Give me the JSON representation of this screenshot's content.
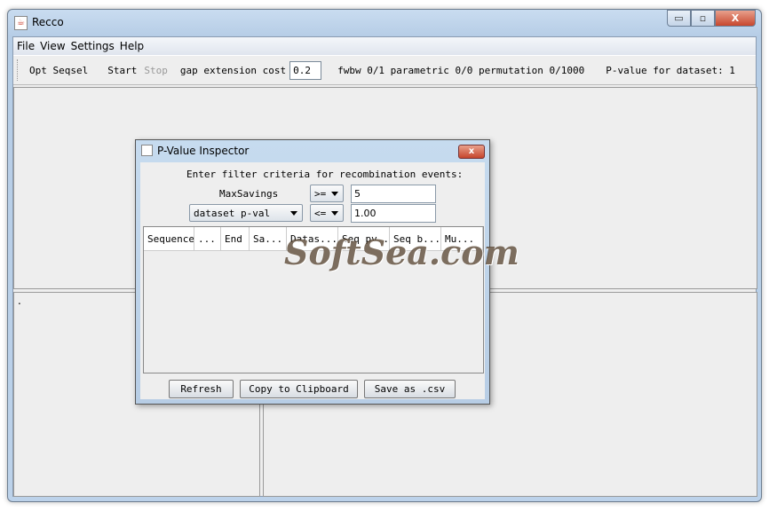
{
  "window": {
    "title": "Recco",
    "min": "▭",
    "max": "▫",
    "close": "X"
  },
  "menu": [
    "File",
    "View",
    "Settings",
    "Help"
  ],
  "toolbar": {
    "opt_seqsel": "Opt Seqsel",
    "start": "Start",
    "stop": "Stop",
    "gap_label": "gap extension cost",
    "gap_value": "0.2",
    "status": "fwbw 0/1 parametric 0/0 permutation 0/1000",
    "pvalue": "P-value for dataset: 1"
  },
  "dialog": {
    "title": "P-Value Inspector",
    "close": "x",
    "prompt": "Enter filter criteria for recombination events:",
    "row1": {
      "label": "MaxSavings",
      "operator": ">=",
      "value": "5"
    },
    "row2": {
      "field": "dataset p-val",
      "operator": "<=",
      "value": "1.00"
    },
    "columns": [
      "Sequence",
      "...",
      "End",
      "Sa...",
      "Datas...",
      "Seq pv...",
      "Seq b...",
      "Mu..."
    ],
    "buttons": {
      "refresh": "Refresh",
      "copy": "Copy to Clipboard",
      "save": "Save as .csv"
    }
  },
  "watermark": "SoftSea.com",
  "bottom_left_text": "."
}
